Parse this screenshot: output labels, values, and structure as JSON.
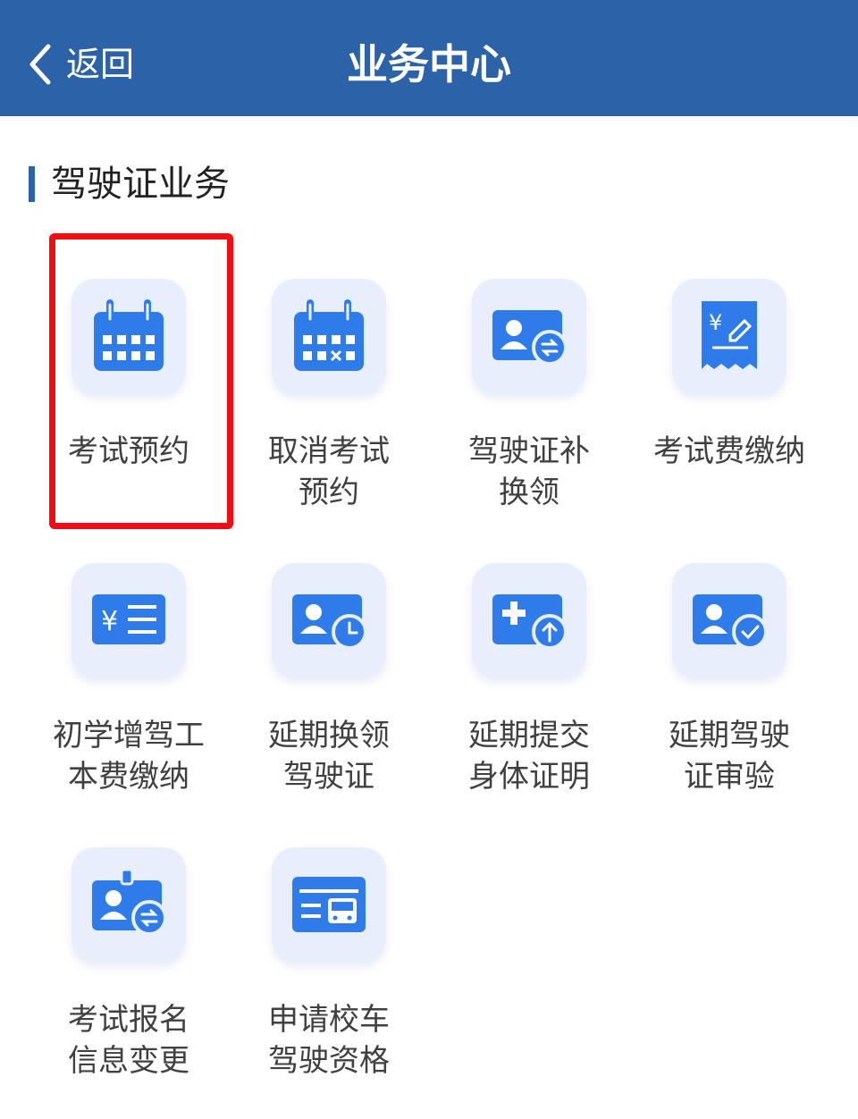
{
  "header": {
    "back_label": "返回",
    "title": "业务中心",
    "background": "#2c63a8"
  },
  "section": {
    "title": "驾驶证业务"
  },
  "services": [
    {
      "label": "考试预约",
      "icon": "calendar-icon",
      "highlighted": true
    },
    {
      "label": "取消考试\n预约",
      "icon": "calendar-cancel-icon"
    },
    {
      "label": "驾驶证补\n换领",
      "icon": "license-swap-icon"
    },
    {
      "label": "考试费缴纳",
      "icon": "fee-receipt-icon"
    },
    {
      "label": "初学增驾工\n本费缴纳",
      "icon": "fee-list-icon"
    },
    {
      "label": "延期换领\n驾驶证",
      "icon": "license-clock-icon"
    },
    {
      "label": "延期提交\n身体证明",
      "icon": "medical-upload-icon"
    },
    {
      "label": "延期驾驶\n证审验",
      "icon": "license-check-icon"
    },
    {
      "label": "考试报名\n信息变更",
      "icon": "badge-swap-icon"
    },
    {
      "label": "申请校车\n驾驶资格",
      "icon": "school-bus-icon"
    }
  ],
  "colors": {
    "accent": "#2f7bea",
    "icon_bg": "#e8eefb",
    "highlight": "#f10d14"
  }
}
